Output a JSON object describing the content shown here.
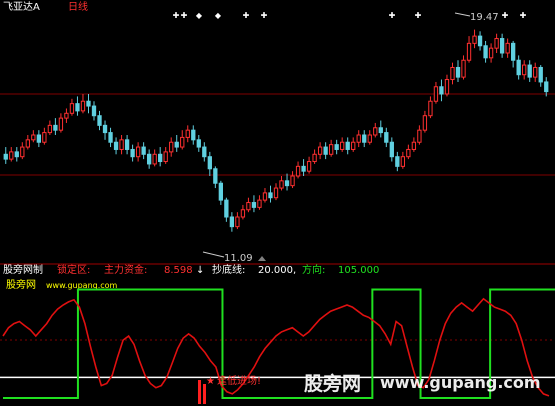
{
  "header": {
    "stock_name": "飞亚达A",
    "period": "日线"
  },
  "price_panel": {
    "high_label": "19.47",
    "low_label": "11.09"
  },
  "indicator_panel": {
    "indicator_name": "股旁网制",
    "lock_label": "锁定区:",
    "main_fund_label": "主力资金:",
    "main_fund_value": "8.598",
    "bottom_line_label": "抄底线:",
    "bottom_line_value": "20.000,",
    "direction_label": "方向:",
    "direction_value": "105.000",
    "site_name": "股旁网",
    "site_url": "www.gupang.com",
    "signal_text": "逢低进场!"
  },
  "watermark": {
    "brand": "股旁网",
    "url": "www.gupang.com"
  },
  "colors": {
    "background": "#000000",
    "up": "#ff3030",
    "down": "#60d0e0",
    "grid": "#800000",
    "main_fund_line": "#e01010",
    "direction_line": "#20e020",
    "bottom_line": "#ffffff",
    "label_red": "#ff3030",
    "label_green": "#20e020",
    "label_white": "#ffffff",
    "label_yellow": "#ffff00"
  },
  "chart_data": [
    {
      "type": "candlestick",
      "title": "飞亚达A 日线",
      "ylim": [
        10.0,
        20.2
      ],
      "annotations": [
        {
          "text": "19.47",
          "value": 19.47
        },
        {
          "text": "11.09",
          "value": 11.09
        }
      ],
      "series": [
        {
          "values": [
            [
              14.3,
              14.1,
              14.6,
              13.9
            ],
            [
              14.1,
              14.4,
              14.6,
              14.0
            ],
            [
              14.4,
              14.2,
              14.6,
              14.0
            ],
            [
              14.2,
              14.6,
              14.8,
              14.1
            ],
            [
              14.6,
              14.9,
              15.1,
              14.5
            ],
            [
              14.9,
              15.1,
              15.3,
              14.8
            ],
            [
              15.1,
              14.8,
              15.3,
              14.6
            ],
            [
              14.8,
              15.2,
              15.4,
              14.7
            ],
            [
              15.2,
              15.5,
              15.7,
              15.1
            ],
            [
              15.5,
              15.3,
              15.8,
              15.1
            ],
            [
              15.3,
              15.8,
              16.0,
              15.2
            ],
            [
              15.8,
              16.0,
              16.2,
              15.6
            ],
            [
              16.0,
              16.4,
              16.6,
              15.9
            ],
            [
              16.4,
              16.1,
              16.7,
              15.9
            ],
            [
              16.1,
              16.5,
              16.8,
              16.0
            ],
            [
              16.5,
              16.3,
              16.8,
              16.0
            ],
            [
              16.3,
              15.9,
              16.5,
              15.7
            ],
            [
              15.9,
              15.5,
              16.1,
              15.3
            ],
            [
              15.5,
              15.2,
              15.7,
              14.9
            ],
            [
              15.2,
              14.8,
              15.4,
              14.6
            ],
            [
              14.8,
              14.5,
              15.0,
              14.3
            ],
            [
              14.5,
              14.9,
              15.1,
              14.3
            ],
            [
              14.9,
              14.5,
              15.1,
              14.3
            ],
            [
              14.5,
              14.2,
              14.7,
              14.0
            ],
            [
              14.2,
              14.6,
              14.8,
              14.0
            ],
            [
              14.6,
              14.3,
              14.8,
              14.1
            ],
            [
              14.3,
              13.9,
              14.5,
              13.7
            ],
            [
              13.9,
              14.3,
              14.5,
              13.8
            ],
            [
              14.3,
              14.0,
              14.6,
              13.8
            ],
            [
              14.0,
              14.4,
              14.6,
              13.9
            ],
            [
              14.4,
              14.8,
              15.0,
              14.2
            ],
            [
              14.8,
              14.6,
              15.1,
              14.4
            ],
            [
              14.6,
              15.0,
              15.3,
              14.5
            ],
            [
              15.0,
              15.3,
              15.5,
              14.8
            ],
            [
              15.3,
              14.9,
              15.5,
              14.7
            ],
            [
              14.9,
              14.6,
              15.1,
              14.4
            ],
            [
              14.6,
              14.2,
              14.8,
              14.0
            ],
            [
              14.2,
              13.7,
              14.4,
              13.4
            ],
            [
              13.7,
              13.1,
              13.8,
              12.9
            ],
            [
              13.1,
              12.4,
              13.2,
              12.2
            ],
            [
              12.4,
              11.7,
              12.5,
              11.5
            ],
            [
              11.7,
              11.3,
              11.9,
              11.09
            ],
            [
              11.3,
              11.7,
              11.9,
              11.2
            ],
            [
              11.7,
              12.0,
              12.2,
              11.6
            ],
            [
              12.0,
              12.3,
              12.5,
              11.9
            ],
            [
              12.3,
              12.1,
              12.6,
              11.9
            ],
            [
              12.1,
              12.4,
              12.6,
              12.0
            ],
            [
              12.4,
              12.7,
              12.9,
              12.3
            ],
            [
              12.7,
              12.5,
              13.0,
              12.3
            ],
            [
              12.5,
              12.9,
              13.1,
              12.4
            ],
            [
              12.9,
              13.2,
              13.4,
              12.8
            ],
            [
              13.2,
              13.0,
              13.5,
              12.8
            ],
            [
              13.0,
              13.4,
              13.6,
              12.9
            ],
            [
              13.4,
              13.8,
              14.0,
              13.3
            ],
            [
              13.8,
              13.6,
              14.1,
              13.4
            ],
            [
              13.6,
              14.0,
              14.2,
              13.5
            ],
            [
              14.0,
              14.3,
              14.5,
              13.9
            ],
            [
              14.3,
              14.6,
              14.8,
              14.1
            ],
            [
              14.6,
              14.3,
              14.8,
              14.1
            ],
            [
              14.3,
              14.7,
              14.9,
              14.2
            ],
            [
              14.7,
              14.5,
              14.9,
              14.3
            ],
            [
              14.5,
              14.8,
              15.0,
              14.4
            ],
            [
              14.8,
              14.5,
              15.0,
              14.3
            ],
            [
              14.5,
              14.8,
              15.0,
              14.4
            ],
            [
              14.8,
              15.1,
              15.3,
              14.6
            ],
            [
              15.1,
              14.8,
              15.3,
              14.6
            ],
            [
              14.8,
              15.1,
              15.3,
              14.7
            ],
            [
              15.1,
              15.4,
              15.6,
              15.0
            ],
            [
              15.4,
              15.2,
              15.7,
              15.0
            ],
            [
              15.2,
              14.8,
              15.4,
              14.6
            ],
            [
              14.8,
              14.2,
              15.0,
              14.0
            ],
            [
              14.2,
              13.8,
              14.4,
              13.6
            ],
            [
              13.8,
              14.2,
              14.4,
              13.7
            ],
            [
              14.2,
              14.5,
              14.7,
              14.1
            ],
            [
              14.5,
              14.8,
              15.0,
              14.4
            ],
            [
              14.8,
              15.3,
              15.5,
              14.7
            ],
            [
              15.3,
              15.9,
              16.1,
              15.2
            ],
            [
              15.9,
              16.5,
              16.7,
              15.8
            ],
            [
              16.5,
              17.1,
              17.3,
              16.4
            ],
            [
              17.1,
              16.8,
              17.4,
              16.5
            ],
            [
              16.8,
              17.4,
              17.6,
              16.7
            ],
            [
              17.4,
              17.9,
              18.1,
              17.2
            ],
            [
              17.9,
              17.5,
              18.2,
              17.3
            ],
            [
              17.5,
              18.2,
              18.4,
              17.4
            ],
            [
              18.2,
              18.9,
              19.2,
              18.1
            ],
            [
              18.9,
              19.2,
              19.47,
              18.7
            ],
            [
              19.2,
              18.8,
              19.4,
              18.6
            ],
            [
              18.8,
              18.3,
              19.0,
              18.1
            ],
            [
              18.3,
              18.7,
              18.9,
              18.1
            ],
            [
              18.7,
              19.1,
              19.3,
              18.5
            ],
            [
              19.1,
              18.5,
              19.3,
              18.3
            ],
            [
              18.5,
              18.9,
              19.1,
              18.3
            ],
            [
              18.9,
              18.2,
              19.0,
              17.9
            ],
            [
              18.2,
              17.6,
              18.4,
              17.4
            ],
            [
              17.6,
              18.0,
              18.2,
              17.4
            ],
            [
              18.0,
              17.5,
              18.2,
              17.3
            ],
            [
              17.5,
              17.9,
              18.1,
              17.3
            ],
            [
              17.9,
              17.3,
              18.0,
              17.1
            ],
            [
              17.3,
              16.9,
              17.5,
              16.7
            ]
          ]
        }
      ]
    },
    {
      "type": "line",
      "title": "股旁网制",
      "ylim": [
        0,
        120
      ],
      "series": [
        {
          "name": "主力资金",
          "values": [
            60,
            68,
            72,
            74,
            70,
            66,
            60,
            66,
            72,
            80,
            86,
            90,
            93,
            95,
            88,
            72,
            50,
            30,
            12,
            14,
            22,
            40,
            56,
            60,
            52,
            36,
            22,
            14,
            10,
            12,
            20,
            34,
            48,
            58,
            62,
            58,
            50,
            44,
            36,
            30,
            12,
            6,
            4,
            8,
            14,
            22,
            30,
            40,
            48,
            54,
            60,
            64,
            66,
            68,
            64,
            60,
            64,
            70,
            76,
            80,
            84,
            86,
            88,
            90,
            88,
            84,
            80,
            78,
            74,
            70,
            62,
            52,
            74,
            70,
            50,
            30,
            12,
            10,
            18,
            36,
            56,
            72,
            82,
            88,
            92,
            88,
            84,
            90,
            96,
            92,
            88,
            86,
            84,
            80,
            72,
            56,
            36,
            20,
            10,
            4,
            2
          ]
        },
        {
          "name": "方向",
          "values": [
            0,
            0,
            0,
            0,
            0,
            0,
            0,
            0,
            0,
            0,
            0,
            0,
            0,
            0,
            105,
            105,
            105,
            105,
            105,
            105,
            105,
            105,
            105,
            105,
            105,
            105,
            105,
            105,
            105,
            105,
            105,
            105,
            105,
            105,
            105,
            105,
            105,
            105,
            105,
            105,
            105,
            0,
            0,
            0,
            0,
            0,
            0,
            0,
            0,
            0,
            0,
            0,
            0,
            0,
            0,
            0,
            0,
            0,
            0,
            0,
            0,
            0,
            0,
            0,
            0,
            0,
            0,
            0,
            0,
            105,
            105,
            105,
            105,
            105,
            105,
            105,
            105,
            105,
            0,
            0,
            0,
            0,
            0,
            0,
            0,
            0,
            0,
            0,
            0,
            0,
            0,
            105,
            105,
            105,
            105,
            105,
            105,
            105,
            105,
            105,
            105,
            105,
            105
          ]
        },
        {
          "name": "抄底线",
          "values": [
            20
          ]
        }
      ]
    }
  ]
}
